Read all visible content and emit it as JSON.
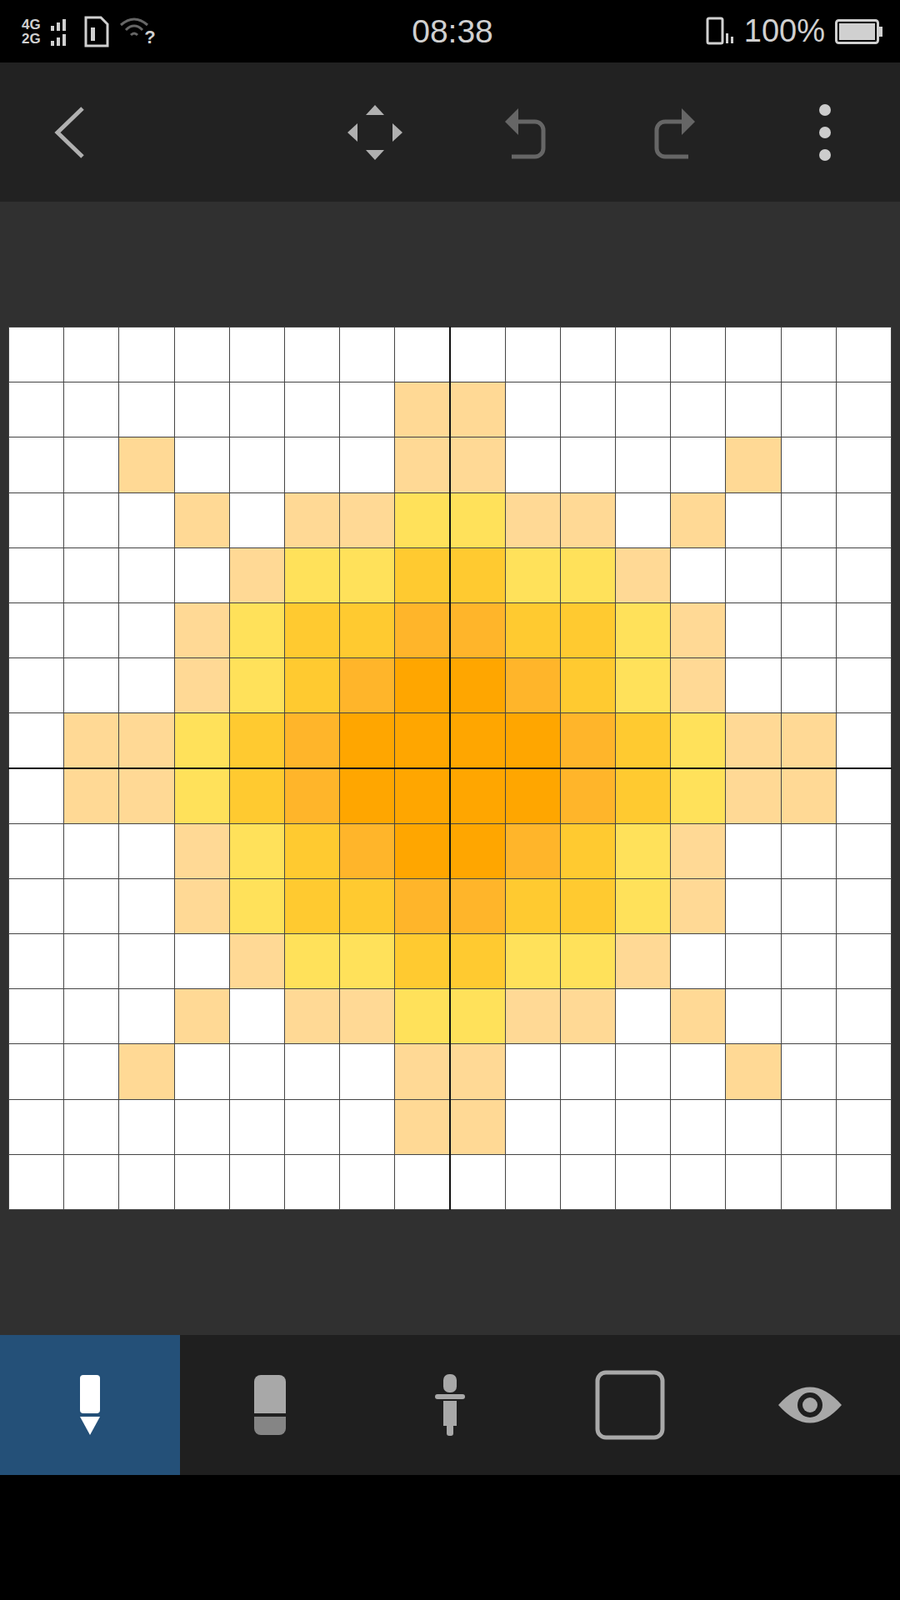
{
  "status_bar": {
    "network_top": "4G",
    "network_bottom": "2G",
    "wifi": "?",
    "time": "08:38",
    "battery": "100%"
  },
  "toolbar": {
    "actions": [
      {
        "disabled": false
      },
      {
        "disabled": false
      },
      {
        "disabled": true
      },
      {
        "disabled": true
      },
      {
        "disabled": false
      }
    ]
  },
  "canvas": {
    "rows": [
      [
        "#ffffff",
        "#ffffff",
        "#ffffff",
        "#ffffff",
        "#ffffff",
        "#ffffff",
        "#ffffff",
        "#ffffff",
        "#ffffff",
        "#ffffff",
        "#ffffff",
        "#ffffff",
        "#ffffff",
        "#ffffff",
        "#ffffff",
        "#ffffff"
      ],
      [
        "#ffffff",
        "#ffffff",
        "#ffffff",
        "#ffffff",
        "#ffffff",
        "#ffffff",
        "#ffffff",
        "#ffd995",
        "#ffd995",
        "#ffffff",
        "#ffffff",
        "#ffffff",
        "#ffffff",
        "#ffffff",
        "#ffffff",
        "#ffffff"
      ],
      [
        "#ffffff",
        "#ffffff",
        "#ffd995",
        "#ffffff",
        "#ffffff",
        "#ffffff",
        "#ffffff",
        "#ffd995",
        "#ffd995",
        "#ffffff",
        "#ffffff",
        "#ffffff",
        "#ffffff",
        "#ffd995",
        "#ffffff",
        "#ffffff"
      ],
      [
        "#ffffff",
        "#ffffff",
        "#ffffff",
        "#ffd995",
        "#ffffff",
        "#ffd995",
        "#ffd995",
        "#ffe15a",
        "#ffe15a",
        "#ffd995",
        "#ffd995",
        "#ffffff",
        "#ffd995",
        "#ffffff",
        "#ffffff",
        "#ffffff"
      ],
      [
        "#ffffff",
        "#ffffff",
        "#ffffff",
        "#ffffff",
        "#ffd995",
        "#ffe15a",
        "#ffe15a",
        "#ffca30",
        "#ffca30",
        "#ffe15a",
        "#ffe15a",
        "#ffd995",
        "#ffffff",
        "#ffffff",
        "#ffffff",
        "#ffffff"
      ],
      [
        "#ffffff",
        "#ffffff",
        "#ffffff",
        "#ffd995",
        "#ffe15a",
        "#ffca30",
        "#ffca30",
        "#ffb52a",
        "#ffb52a",
        "#ffca30",
        "#ffca30",
        "#ffe15a",
        "#ffd995",
        "#ffffff",
        "#ffffff",
        "#ffffff"
      ],
      [
        "#ffffff",
        "#ffffff",
        "#ffffff",
        "#ffd995",
        "#ffe15a",
        "#ffca30",
        "#ffb52a",
        "#ffa600",
        "#ffa600",
        "#ffb52a",
        "#ffca30",
        "#ffe15a",
        "#ffd995",
        "#ffffff",
        "#ffffff",
        "#ffffff"
      ],
      [
        "#ffffff",
        "#ffd995",
        "#ffd995",
        "#ffe15a",
        "#ffca30",
        "#ffb52a",
        "#ffa600",
        "#ffa600",
        "#ffa600",
        "#ffa600",
        "#ffb52a",
        "#ffca30",
        "#ffe15a",
        "#ffd995",
        "#ffd995",
        "#ffffff"
      ],
      [
        "#ffffff",
        "#ffd995",
        "#ffd995",
        "#ffe15a",
        "#ffca30",
        "#ffb52a",
        "#ffa600",
        "#ffa600",
        "#ffa600",
        "#ffa600",
        "#ffb52a",
        "#ffca30",
        "#ffe15a",
        "#ffd995",
        "#ffd995",
        "#ffffff"
      ],
      [
        "#ffffff",
        "#ffffff",
        "#ffffff",
        "#ffd995",
        "#ffe15a",
        "#ffca30",
        "#ffb52a",
        "#ffa600",
        "#ffa600",
        "#ffb52a",
        "#ffca30",
        "#ffe15a",
        "#ffd995",
        "#ffffff",
        "#ffffff",
        "#ffffff"
      ],
      [
        "#ffffff",
        "#ffffff",
        "#ffffff",
        "#ffd995",
        "#ffe15a",
        "#ffca30",
        "#ffca30",
        "#ffb52a",
        "#ffb52a",
        "#ffca30",
        "#ffca30",
        "#ffe15a",
        "#ffd995",
        "#ffffff",
        "#ffffff",
        "#ffffff"
      ],
      [
        "#ffffff",
        "#ffffff",
        "#ffffff",
        "#ffffff",
        "#ffd995",
        "#ffe15a",
        "#ffe15a",
        "#ffca30",
        "#ffca30",
        "#ffe15a",
        "#ffe15a",
        "#ffd995",
        "#ffffff",
        "#ffffff",
        "#ffffff",
        "#ffffff"
      ],
      [
        "#ffffff",
        "#ffffff",
        "#ffffff",
        "#ffd995",
        "#ffffff",
        "#ffd995",
        "#ffd995",
        "#ffe15a",
        "#ffe15a",
        "#ffd995",
        "#ffd995",
        "#ffffff",
        "#ffd995",
        "#ffffff",
        "#ffffff",
        "#ffffff"
      ],
      [
        "#ffffff",
        "#ffffff",
        "#ffd995",
        "#ffffff",
        "#ffffff",
        "#ffffff",
        "#ffffff",
        "#ffd995",
        "#ffd995",
        "#ffffff",
        "#ffffff",
        "#ffffff",
        "#ffffff",
        "#ffd995",
        "#ffffff",
        "#ffffff"
      ],
      [
        "#ffffff",
        "#ffffff",
        "#ffffff",
        "#ffffff",
        "#ffffff",
        "#ffffff",
        "#ffffff",
        "#ffd995",
        "#ffd995",
        "#ffffff",
        "#ffffff",
        "#ffffff",
        "#ffffff",
        "#ffffff",
        "#ffffff",
        "#ffffff"
      ],
      [
        "#ffffff",
        "#ffffff",
        "#ffffff",
        "#ffffff",
        "#ffffff",
        "#ffffff",
        "#ffffff",
        "#ffffff",
        "#ffffff",
        "#ffffff",
        "#ffffff",
        "#ffffff",
        "#ffffff",
        "#ffffff",
        "#ffffff",
        "#ffffff"
      ]
    ]
  },
  "tools": [
    {
      "selected": true
    },
    {
      "selected": false
    },
    {
      "selected": false
    },
    {
      "selected": false
    },
    {
      "selected": false
    }
  ]
}
